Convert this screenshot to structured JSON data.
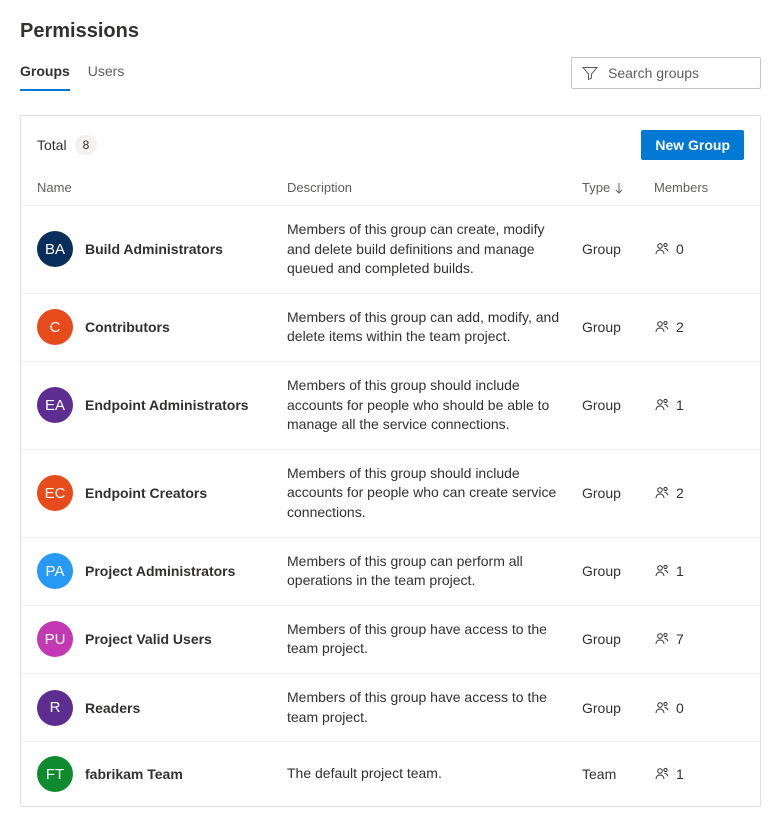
{
  "page_title": "Permissions",
  "tabs": {
    "groups": "Groups",
    "users": "Users"
  },
  "search": {
    "placeholder": "Search groups"
  },
  "total_label": "Total",
  "total_count": "8",
  "new_group_label": "New Group",
  "headers": {
    "name": "Name",
    "description": "Description",
    "type": "Type",
    "members": "Members"
  },
  "rows": [
    {
      "initials": "BA",
      "color": "#0a2e5c",
      "name": "Build Administrators",
      "description": "Members of this group can create, modify and delete build definitions and manage queued and completed builds.",
      "type": "Group",
      "members": "0"
    },
    {
      "initials": "C",
      "color": "#e74b1c",
      "name": "Contributors",
      "description": "Members of this group can add, modify, and delete items within the team project.",
      "type": "Group",
      "members": "2"
    },
    {
      "initials": "EA",
      "color": "#5c2e91",
      "name": "Endpoint Administrators",
      "description": "Members of this group should include accounts for people who should be able to manage all the service connections.",
      "type": "Group",
      "members": "1"
    },
    {
      "initials": "EC",
      "color": "#e74b1c",
      "name": "Endpoint Creators",
      "description": "Members of this group should include accounts for people who can create service connections.",
      "type": "Group",
      "members": "2"
    },
    {
      "initials": "PA",
      "color": "#2899f5",
      "name": "Project Administrators",
      "description": "Members of this group can perform all operations in the team project.",
      "type": "Group",
      "members": "1"
    },
    {
      "initials": "PU",
      "color": "#c239b3",
      "name": "Project Valid Users",
      "description": "Members of this group have access to the team project.",
      "type": "Group",
      "members": "7"
    },
    {
      "initials": "R",
      "color": "#5c2e91",
      "name": "Readers",
      "description": "Members of this group have access to the team project.",
      "type": "Group",
      "members": "0"
    },
    {
      "initials": "FT",
      "color": "#0f8a2f",
      "name": "fabrikam Team",
      "description": "The default project team.",
      "type": "Team",
      "members": "1"
    }
  ]
}
